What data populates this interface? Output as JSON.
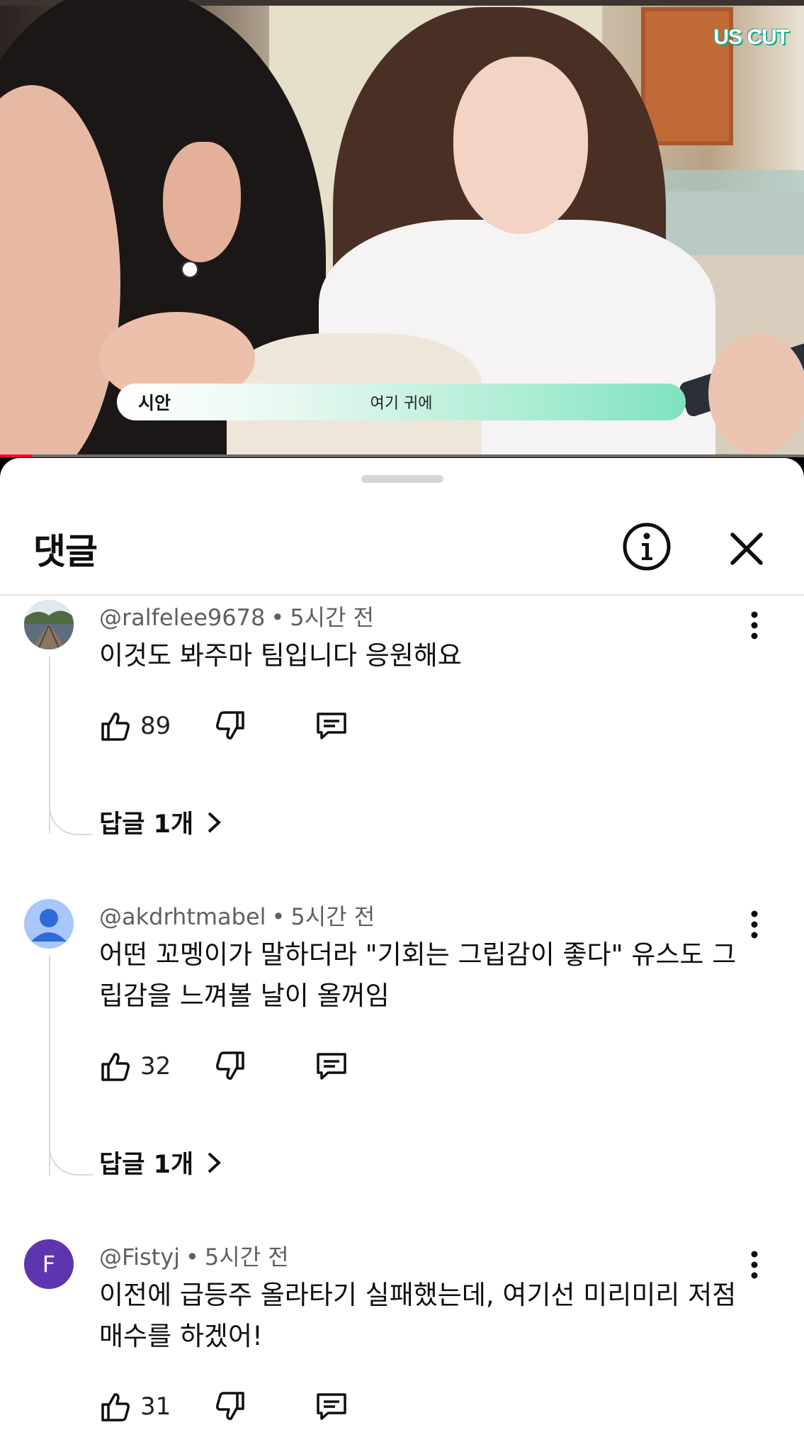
{
  "video": {
    "watermark": "US CUT",
    "caption_speaker": "시안",
    "caption_text": "여기 귀에",
    "progress_fraction": 0.04
  },
  "sheet": {
    "title": "댓글",
    "info_icon": "info-icon",
    "close_icon": "close-icon"
  },
  "comments": [
    {
      "author": "@ralfelee9678",
      "time": "5시간 전",
      "text": "이것도 봐주마 팀입니다 응원해요",
      "likes": "89",
      "replies": "답글 1개",
      "avatar_type": "photo"
    },
    {
      "author": "@akdrhtmabel",
      "time": "5시간 전",
      "text": "어떤 꼬멩이가 말하더라 \"기회는 그립감이 좋다\" 유스도 그립감을 느껴볼 날이 올꺼임",
      "likes": "32",
      "replies": "답글 1개",
      "avatar_type": "default-person",
      "avatar_color": "#a8c7fa"
    },
    {
      "author": "@Fistyj",
      "time": "5시간 전",
      "text": "이전에 급등주 올라타기 실패했는데, 여기선 미리미리 저점 매수를 하겠어!",
      "likes": "31",
      "avatar_type": "letter",
      "avatar_letter": "F",
      "avatar_color": "#5e35b1"
    }
  ],
  "separator": "•"
}
